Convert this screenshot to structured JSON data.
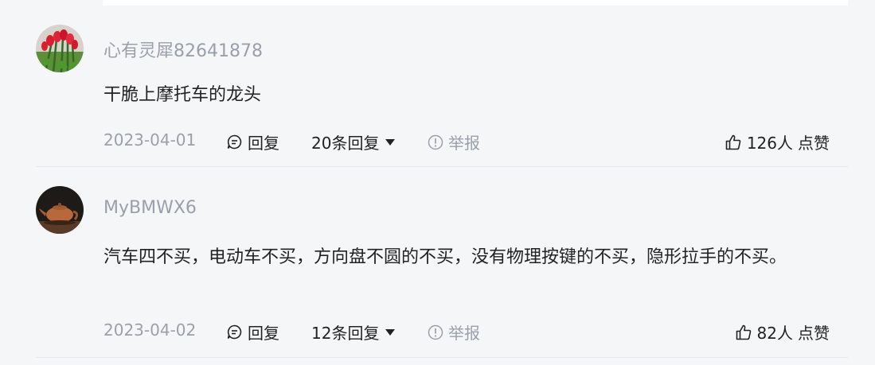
{
  "comments": [
    {
      "username": "心有灵犀82641878",
      "avatar_icon": "tulip-avatar-icon",
      "body": "干脆上摩托车的龙头",
      "date": "2023-04-01",
      "reply_label": "回复",
      "replies_label": "20条回复",
      "report_label": "举报",
      "likes_count": "126人",
      "likes_label": "点赞"
    },
    {
      "username": "MyBMWX6",
      "avatar_icon": "teapot-avatar-icon",
      "body": "汽车四不买，电动车不买，方向盘不圆的不买，没有物理按键的不买，隐形拉手的不买。",
      "date": "2023-04-02",
      "reply_label": "回复",
      "replies_label": "12条回复",
      "report_label": "举报",
      "likes_count": "82人",
      "likes_label": "点赞"
    }
  ],
  "colors": {
    "background": "#f5f6f8",
    "muted_text": "#9aa0ab",
    "primary_text": "#222222"
  }
}
